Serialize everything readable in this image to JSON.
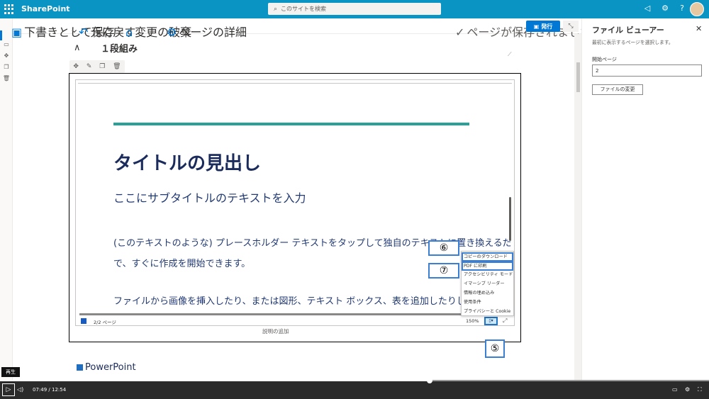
{
  "suite": {
    "app_name": "SharePoint",
    "search_placeholder": "このサイトを検索"
  },
  "commandbar": {
    "save_draft": "下書きとして保存",
    "undo": "元に戻す",
    "discard": "変更の破棄",
    "page_details": "ページの詳細",
    "saved_status": "ページが保存されました",
    "publish": "発行"
  },
  "section": {
    "title": "１段組み"
  },
  "slide": {
    "title": "タイトルの見出し",
    "subtitle": "ここにサブタイトルのテキストを入力",
    "body_line1": "(このテキストのような) プレースホルダー テキストをタップして独自のテキストに置き換えるだけ",
    "body_line2": "で、すぐに作成を開始できます。",
    "body_line3": "ファイルから画像を挿入したり、または図形、テキスト ボックス、表を追加したりしたいとし"
  },
  "viewer": {
    "page_count": "2/2 ページ",
    "zoom": "150%",
    "caption": "説明の追加"
  },
  "menu": {
    "items": [
      "コピーのダウンロード",
      "PDF に印刷",
      "アクセシビリティ モード",
      "イマーシブ リーダー",
      "情報の埋め込み",
      "使用条件",
      "プライバシーと Cookie"
    ]
  },
  "callouts": {
    "five": "⑤",
    "six": "⑥",
    "seven": "⑦"
  },
  "content": {
    "ppt_label": "PowerPoint"
  },
  "panel": {
    "title": "ファイル ビューアー",
    "description": "最初に表示するページを選択します。",
    "start_page_label": "開始ページ",
    "start_page_value": "2",
    "change_file": "ファイルの変更"
  },
  "video": {
    "tooltip": "再生",
    "current": "07:49",
    "separator": "/",
    "total": "12:54",
    "progress": 0.606
  },
  "icons": {
    "search": "search-icon",
    "megaphone": "megaphone-icon",
    "gear": "gear-icon",
    "help": "help-icon",
    "save": "save-icon",
    "undo": "undo-icon",
    "discard": "discard-icon",
    "details": "gear-icon",
    "check": "check-icon",
    "play": "play-icon"
  },
  "colors": {
    "suite_bar": "#0a94c4",
    "accent": "#0078d4",
    "teal": "#2aa198",
    "slide_text": "#1b2b5b",
    "callout_border": "#3b7fd4"
  }
}
